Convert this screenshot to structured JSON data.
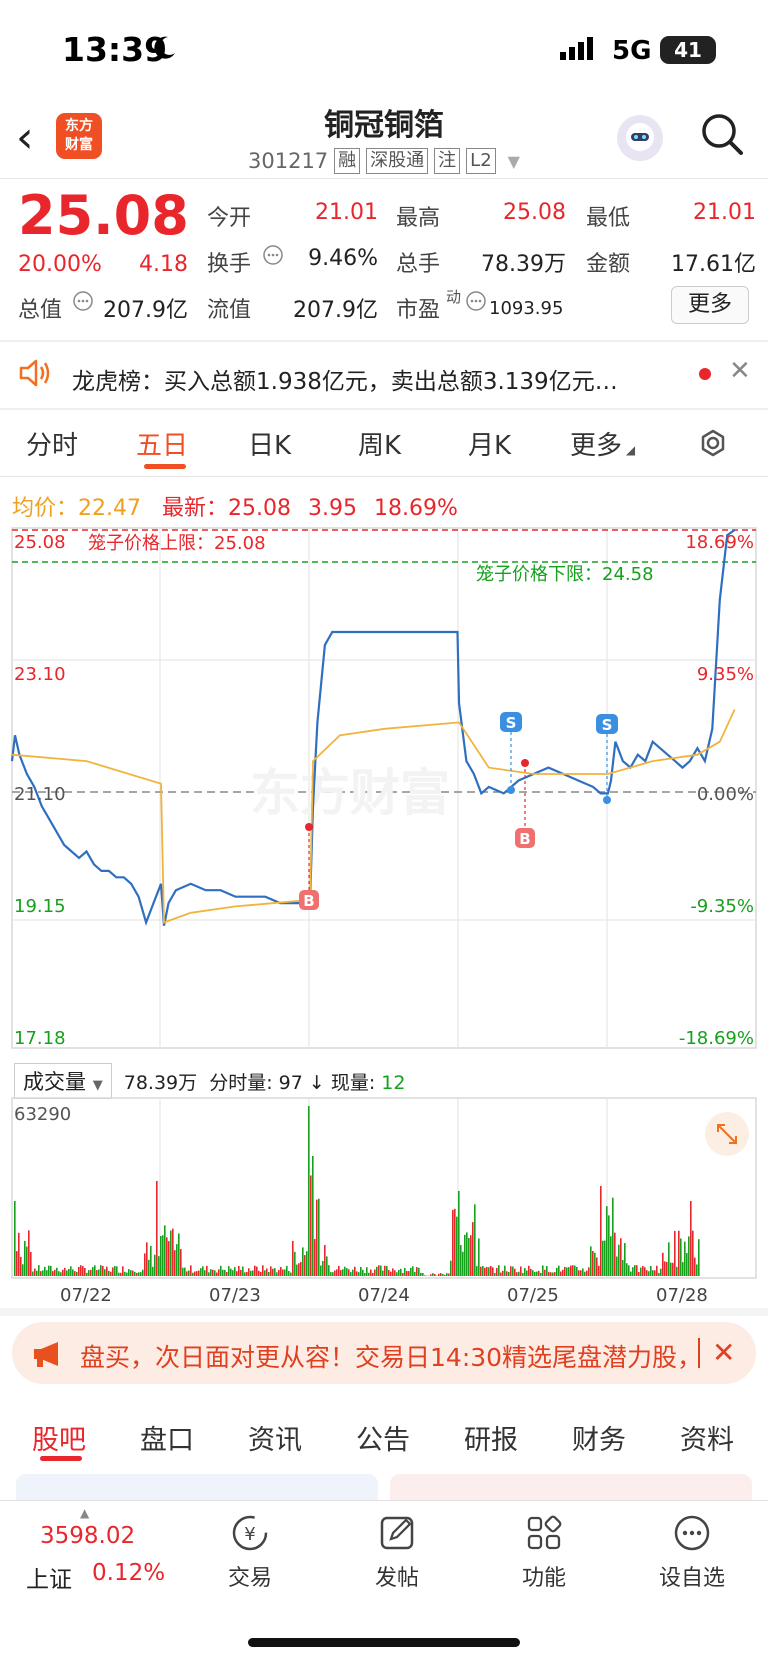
{
  "status": {
    "time": "13:39",
    "network": "5G",
    "battery": "41"
  },
  "header": {
    "logo": [
      "东方",
      "财富"
    ],
    "name": "铜冠铜箔",
    "code": "301217",
    "tags": [
      "融",
      "深股通",
      "注",
      "L2"
    ]
  },
  "quote": {
    "price": "25.08",
    "change_pct": "20.00%",
    "change": "4.18",
    "open_label": "今开",
    "open": "21.01",
    "high_label": "最高",
    "high": "25.08",
    "low_label": "最低",
    "low": "21.01",
    "turnover_label": "换手",
    "turnover": "9.46%",
    "volume_label": "总手",
    "volume": "78.39万",
    "amount_label": "金额",
    "amount": "17.61亿",
    "mcap_label": "总值",
    "mcap": "207.9亿",
    "float_label": "流值",
    "float": "207.9亿",
    "pe_label": "市盈",
    "pe_sup": "动",
    "pe": "1093.95",
    "more": "更多"
  },
  "dragon_tiger": {
    "text": "龙虎榜：买入总额1.938亿元，卖出总额3.139亿元…"
  },
  "tabs": [
    "分时",
    "五日",
    "日K",
    "周K",
    "月K",
    "更多"
  ],
  "active_tab": "五日",
  "info": {
    "avg_label": "均价：",
    "avg": "22.47",
    "latest_label": "最新：",
    "latest": "25.08",
    "change": "3.95",
    "change_pct": "18.69%"
  },
  "chart_data": {
    "type": "line",
    "price_axis": [
      "25.08",
      "23.10",
      "21.10",
      "19.15",
      "17.18"
    ],
    "pct_axis": [
      "18.69%",
      "9.35%",
      "0.00%",
      "-9.35%",
      "-18.69%"
    ],
    "limit_up_label": "笼子价格上限：25.08",
    "limit_down_label": "笼子价格下限：24.58",
    "dates": [
      "07/22",
      "07/23",
      "07/24",
      "07/25",
      "07/28"
    ],
    "ylim": [
      17.18,
      25.08
    ],
    "prev_close": 21.1,
    "series": [
      {
        "x": [
          0,
          0.02,
          0.05,
          0.1,
          0.15,
          0.2,
          0.25,
          0.3,
          0.35,
          0.4,
          0.45,
          0.5,
          0.55,
          0.6,
          0.65,
          0.7,
          0.75,
          0.8,
          0.85,
          0.9,
          0.95,
          1.0,
          1.02,
          1.05,
          1.1,
          1.2,
          1.3,
          1.4,
          1.5,
          1.6,
          1.7,
          1.8,
          1.9,
          2.0,
          2.02,
          2.05,
          2.1,
          2.15,
          2.5,
          2.99,
          3.0,
          3.05,
          3.1,
          3.15,
          3.2,
          3.3,
          3.4,
          3.5,
          3.6,
          3.7,
          3.8,
          3.9,
          3.95,
          4.0,
          4.02,
          4.05,
          4.1,
          4.15,
          4.2,
          4.25,
          4.3,
          4.35,
          4.4,
          4.45,
          4.5,
          4.55,
          4.6,
          4.65,
          4.7,
          4.75,
          4.8,
          4.85
        ],
        "y": [
          21.5,
          21.9,
          21.6,
          21.3,
          21.1,
          20.8,
          20.6,
          20.4,
          20.2,
          20.1,
          20.0,
          20.1,
          19.9,
          19.8,
          19.8,
          19.7,
          19.7,
          19.6,
          19.4,
          19.0,
          19.3,
          19.6,
          18.95,
          19.3,
          19.5,
          19.6,
          19.5,
          19.5,
          19.4,
          19.4,
          19.4,
          19.3,
          19.3,
          19.3,
          20.8,
          22.1,
          23.3,
          23.5,
          23.5,
          23.5,
          22.4,
          21.5,
          21.3,
          21.0,
          21.1,
          21.0,
          21.2,
          21.3,
          21.4,
          21.3,
          21.2,
          21.1,
          21.0,
          21.0,
          21.2,
          21.8,
          21.5,
          21.4,
          21.6,
          21.5,
          21.8,
          21.7,
          21.6,
          21.5,
          21.4,
          21.5,
          21.7,
          21.5,
          22.0,
          24.0,
          25.0,
          25.08
        ]
      },
      {
        "x": [
          0,
          0.5,
          1.0,
          1.02,
          1.2,
          1.5,
          2.0,
          2.02,
          2.2,
          2.5,
          3.0,
          3.2,
          3.5,
          4.0,
          4.3,
          4.6,
          4.75,
          4.85
        ],
        "y": [
          21.6,
          21.5,
          21.15,
          19.0,
          19.15,
          19.25,
          19.35,
          21.5,
          21.9,
          22.0,
          22.1,
          21.4,
          21.3,
          21.3,
          21.5,
          21.6,
          21.8,
          22.3
        ]
      }
    ]
  },
  "volume": {
    "select": "成交量",
    "total": "78.39万",
    "tick_label": "分时量:",
    "tick": "97",
    "arrow": "↓",
    "cur_label": "现量:",
    "cur": "12",
    "max": "63290"
  },
  "promo": {
    "text": "盘买，次日面对更从容！交易日14:30精选尾盘潜力股，"
  },
  "bottom_tabs": [
    "股吧",
    "盘口",
    "资讯",
    "公告",
    "研报",
    "财务",
    "资料"
  ],
  "active_bottom_tab": "股吧",
  "index": {
    "value": "3598.02",
    "name": "上证",
    "pct": "0.12%"
  },
  "nav": [
    "交易",
    "发帖",
    "功能",
    "设自选"
  ],
  "colors": {
    "up": "#e8262b",
    "down": "#16a01e",
    "accent": "#f04e23",
    "price_line": "#2f6fc0",
    "avg_line": "#f2b33d"
  }
}
